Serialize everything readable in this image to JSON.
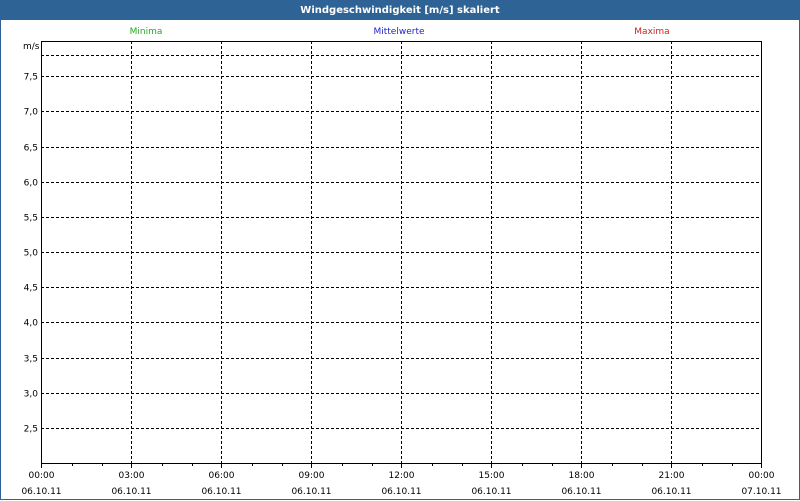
{
  "window": {
    "title": "Windgeschwindigkeit [m/s] skaliert"
  },
  "legend": [
    {
      "label": "Minima",
      "color": "#22aa22"
    },
    {
      "label": "Mittelwerte",
      "color": "#2222cc"
    },
    {
      "label": "Maxima",
      "color": "#cc2222"
    }
  ],
  "chart_data": {
    "type": "line",
    "title": "Windgeschwindigkeit [m/s] skaliert",
    "ylabel": "m/s",
    "xlabel": "",
    "ylim": [
      2.0,
      8.0
    ],
    "y_ticks": [
      "7,5",
      "7,0",
      "6,5",
      "6,0",
      "5,5",
      "5,0",
      "4,5",
      "4,0",
      "3,5",
      "3,0",
      "2,5"
    ],
    "y_tick_values": [
      7.5,
      7.0,
      6.5,
      6.0,
      5.5,
      5.0,
      4.5,
      4.0,
      3.5,
      3.0,
      2.5
    ],
    "x_ticks": [
      {
        "time": "00:00",
        "date": "06.10.11"
      },
      {
        "time": "03:00",
        "date": "06.10.11"
      },
      {
        "time": "06:00",
        "date": "06.10.11"
      },
      {
        "time": "09:00",
        "date": "06.10.11"
      },
      {
        "time": "12:00",
        "date": "06.10.11"
      },
      {
        "time": "15:00",
        "date": "06.10.11"
      },
      {
        "time": "18:00",
        "date": "06.10.11"
      },
      {
        "time": "21:00",
        "date": "06.10.11"
      },
      {
        "time": "00:00",
        "date": "07.10.11"
      }
    ],
    "series": [
      {
        "name": "Minima",
        "values": []
      },
      {
        "name": "Mittelwerte",
        "values": []
      },
      {
        "name": "Maxima",
        "values": []
      }
    ],
    "grid": true
  }
}
